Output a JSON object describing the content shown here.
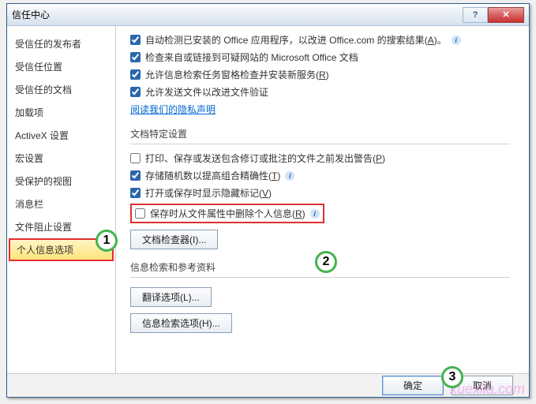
{
  "window": {
    "title": "信任中心"
  },
  "sidebar": {
    "items": [
      "受信任的发布者",
      "受信任位置",
      "受信任的文档",
      "加载项",
      "ActiveX 设置",
      "宏设置",
      "受保护的视图",
      "消息栏",
      "文件阻止设置",
      "个人信息选项"
    ],
    "selected_index": 9
  },
  "privacy_opts": [
    {
      "checked": true,
      "label_a": "自动检测已安装的 Office 应用程序，以改进 Office.com 的搜索结果(",
      "key": "A",
      "label_b": ")。",
      "info": true
    },
    {
      "checked": true,
      "label_a": "检查来自或链接到可疑网站的 Microsoft Office 文档",
      "key": "",
      "label_b": "",
      "info": false
    },
    {
      "checked": true,
      "label_a": "允许信息检索任务窗格检查并安装新服务(",
      "key": "R",
      "label_b": ")",
      "info": false
    },
    {
      "checked": true,
      "label_a": "允许发送文件以改进文件验证",
      "key": "",
      "label_b": "",
      "info": false
    }
  ],
  "privacy_link": "阅读我们的隐私声明",
  "doc_section": "文档特定设置",
  "doc_opts": [
    {
      "checked": false,
      "label_a": "打印、保存或发送包含修订或批注的文件之前发出警告(",
      "key": "P",
      "label_b": ")",
      "info": false
    },
    {
      "checked": true,
      "label_a": "存储随机数以提高组合精确性(",
      "key": "T",
      "label_b": ")",
      "info": true
    },
    {
      "checked": true,
      "label_a": "打开或保存时显示隐藏标记(",
      "key": "V",
      "label_b": ")",
      "info": false
    },
    {
      "checked": false,
      "label_a": "保存时从文件属性中删除个人信息(",
      "key": "R",
      "label_b": ")",
      "info": true,
      "highlight": true
    }
  ],
  "doc_inspector_btn": "文档检查器(I)...",
  "research_section": "信息检索和参考资料",
  "translate_btn": "翻译选项(L)...",
  "research_btn": "信息检索选项(H)...",
  "footer": {
    "ok": "确定",
    "cancel": "取消"
  },
  "callouts": {
    "c1": "1",
    "c2": "2",
    "c3": "3"
  },
  "watermark": "xuexila.com"
}
